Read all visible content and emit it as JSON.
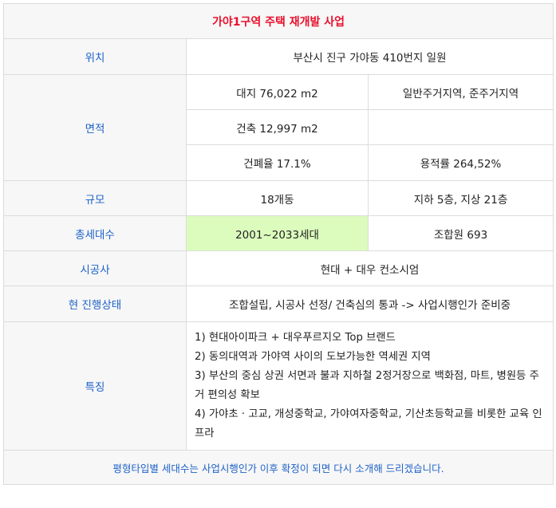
{
  "title": "가야1구역 주택 재개발 사업",
  "rows": {
    "location": {
      "label": "위치",
      "value": "부산시 진구 가야동 410번지 일원"
    },
    "area": {
      "label": "면적",
      "r1c1": "대지 76,022 m2",
      "r1c2": "일반주거지역, 준주거지역",
      "r2c1": "건축 12,997 m2",
      "r2c2": "",
      "r3c1": "건폐율 17.1%",
      "r3c2": "용적률 264,52%"
    },
    "scale": {
      "label": "규모",
      "c1": "18개동",
      "c2": "지하 5층, 지상 21층"
    },
    "households": {
      "label": "총세대수",
      "c1": "2001~2033세대",
      "c2": "조합원 693"
    },
    "builder": {
      "label": "시공사",
      "value": "현대 + 대우 컨소시엄"
    },
    "status": {
      "label": "현 진행상태",
      "value": "조합설립, 시공사 선정/ 건축심의 통과 -> 사업시행인가 준비중"
    },
    "features": {
      "label": "특징",
      "items": [
        "1) 현대아이파크 + 대우푸르지오 Top 브랜드",
        "2) 동의대역과 가야역 사이의 도보가능한 역세권 지역",
        "3) 부산의 중심 상권 서면과 불과 지하철 2정거장으로 백화점, 마트, 병원등 주거 편의성 확보",
        "4) 가야초 · 고교, 개성중학교, 가야여자중학교, 기산초등학교를 비롯한 교육 인프라"
      ]
    }
  },
  "footer": "평형타입별 세대수는 사업시행인가 이후 확정이 되면 다시 소개해 드리겠습니다."
}
